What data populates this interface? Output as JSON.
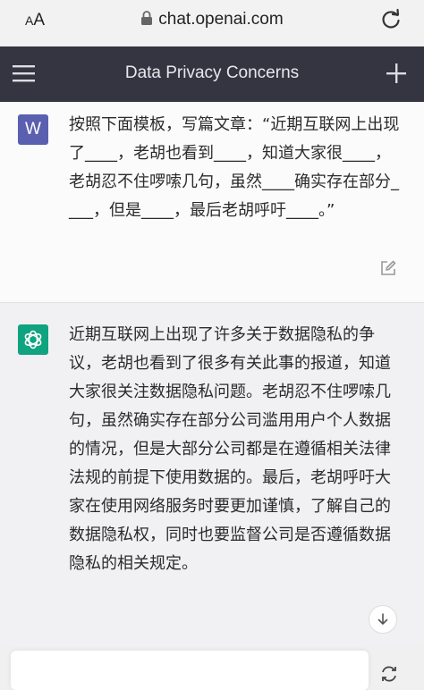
{
  "browser": {
    "text_size_label_small": "A",
    "text_size_label_large": "A",
    "url": "chat.openai.com"
  },
  "header": {
    "title": "Data Privacy Concerns"
  },
  "user_message": {
    "avatar_letter": "W",
    "text": "按照下面模板，写篇文章：“近期互联网上出现了____，老胡也看到____，知道大家很____，老胡忍不住啰嗦几句，虽然____确实存在部分____，但是____，最后老胡呼吁____。”"
  },
  "assistant_message": {
    "text": "近期互联网上出现了许多关于数据隐私的争议，老胡也看到了很多有关此事的报道，知道大家很关注数据隐私问题。老胡忍不住啰嗦几句，虽然确实存在部分公司滥用用户个人数据的情况，但是大部分公司都是在遵循相关法律法规的前提下使用数据的。最后，老胡呼吁大家在使用网络服务时要更加谨慎，了解自己的数据隐私权，同时也要监督公司是否遵循数据隐私的相关规定。"
  },
  "icons": {
    "menu": "hamburger-icon",
    "new_chat": "plus-icon",
    "reload": "reload-icon",
    "lock": "lock-icon",
    "edit": "edit-icon",
    "assistant_avatar": "openai-logo-icon",
    "scroll": "arrow-down-icon",
    "regenerate": "regenerate-icon"
  },
  "colors": {
    "header_bg": "#343541",
    "gpt_green": "#10a37f",
    "user_avatar": "#5a5fb0"
  }
}
